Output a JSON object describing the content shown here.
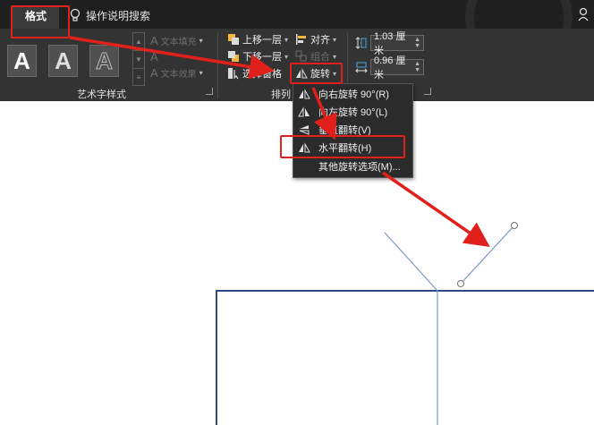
{
  "topbar": {
    "active_tab": "格式",
    "tell_me": "操作说明搜索"
  },
  "ribbon": {
    "wordart_group": {
      "label": "艺术字样式",
      "letter": "A",
      "text_fill": "文本填充",
      "text_effect": "文本效果"
    },
    "arrange_group": {
      "label": "排列",
      "bring_forward": "上移一层",
      "send_backward": "下移一层",
      "selection_pane": "选择窗格",
      "align": "对齐",
      "group": "组合",
      "rotate": "旋转"
    },
    "size_group": {
      "height_value": "1.03 厘米",
      "width_value": "0.96 厘米"
    }
  },
  "rotate_menu": {
    "items": [
      {
        "label": "向右旋转 90°(R)"
      },
      {
        "label": "向左旋转 90°(L)"
      },
      {
        "label": "垂直翻转(V)"
      },
      {
        "label": "水平翻转(H)"
      },
      {
        "label": "其他旋转选项(M)..."
      }
    ]
  },
  "colors": {
    "highlight": "#e0201b",
    "ribbon_bg": "#333333",
    "menu_bg": "#2b2b2b",
    "shape_stroke": "#2f4a7c",
    "line_stroke": "#7a97c9"
  },
  "icons": [
    "lightbulb-icon",
    "share-person-icon",
    "layer-up-icon",
    "layer-down-icon",
    "selection-pane-icon",
    "align-icon",
    "group-icon",
    "rotate-icon",
    "height-icon",
    "width-icon",
    "rotate-right-icon",
    "rotate-left-icon",
    "flip-vertical-icon",
    "flip-horizontal-icon"
  ]
}
